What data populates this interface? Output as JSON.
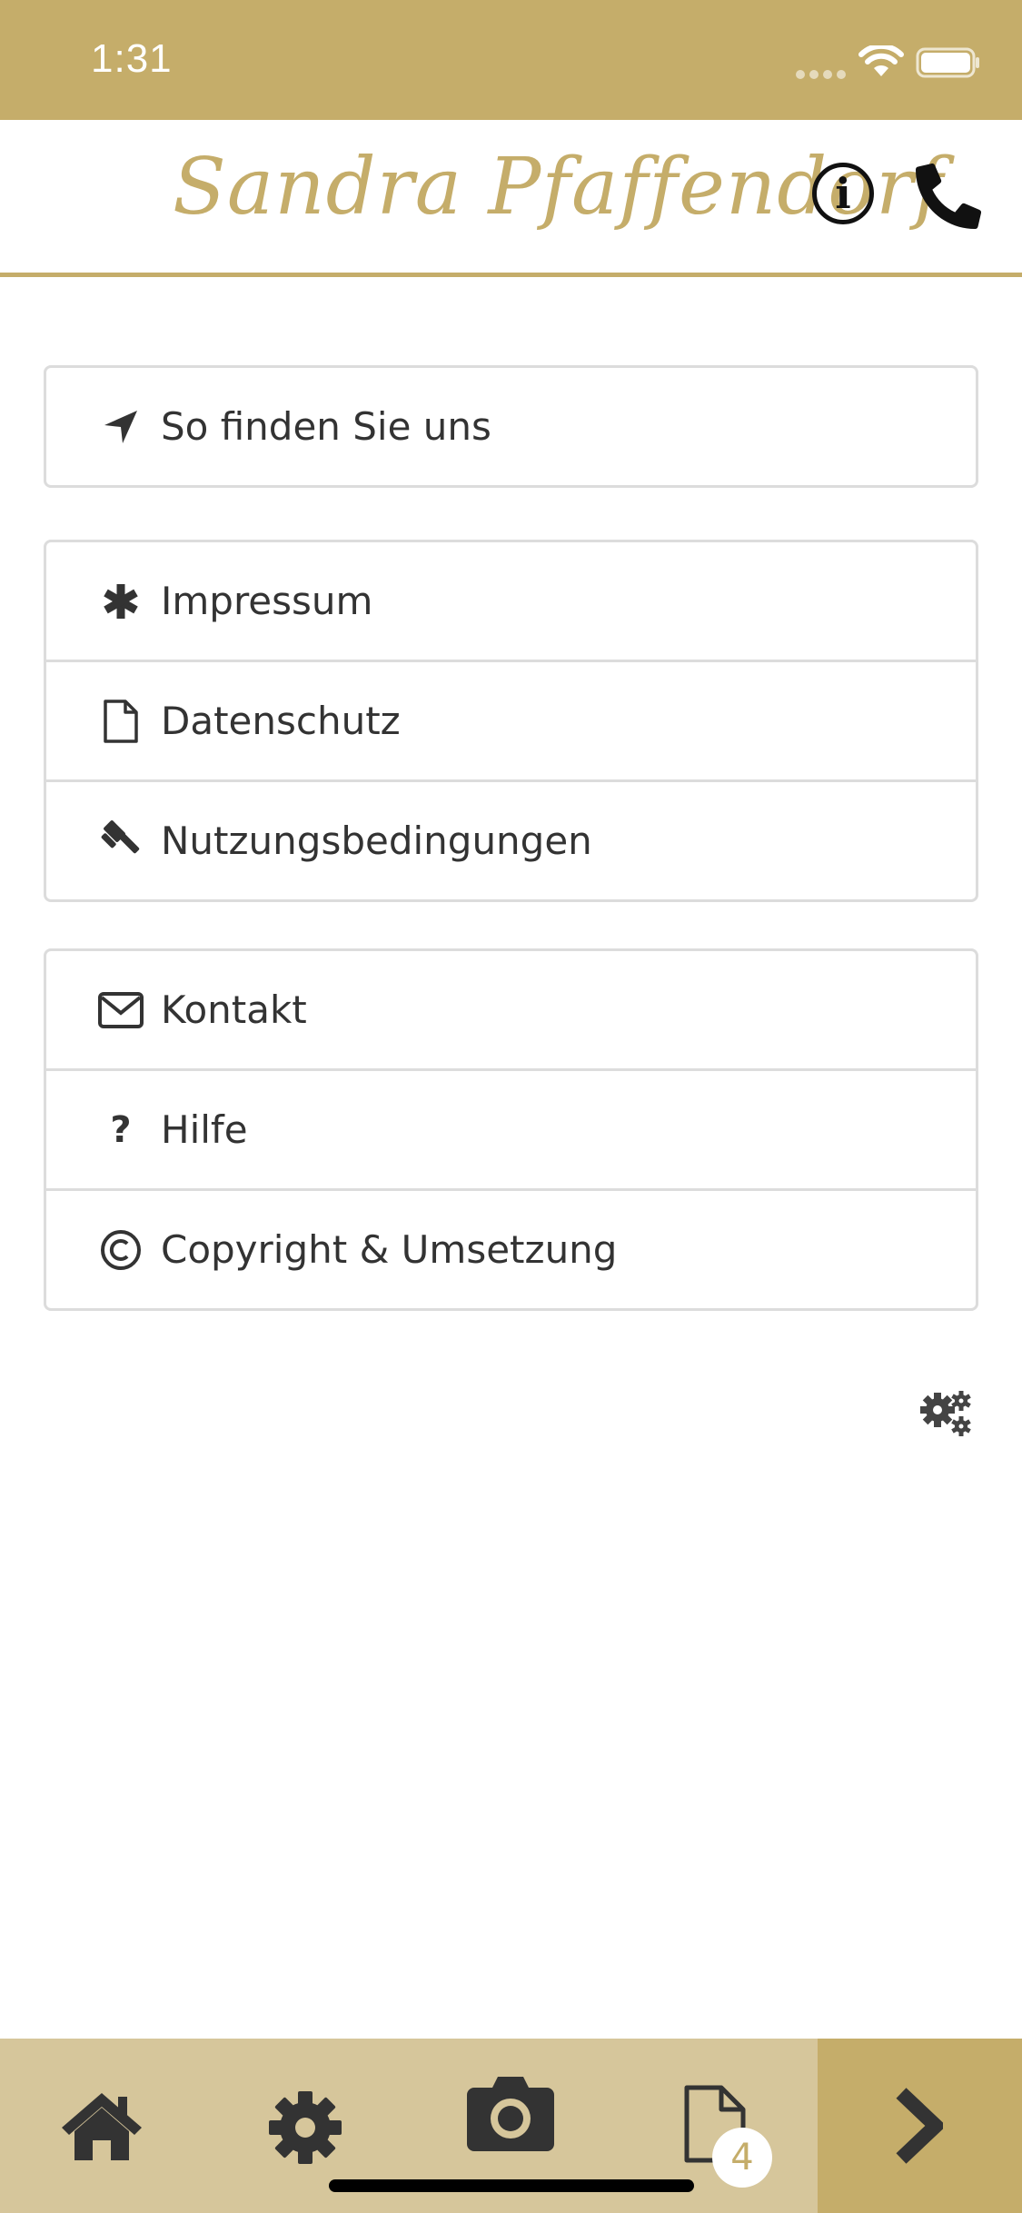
{
  "status_bar": {
    "time": "1:31"
  },
  "header": {
    "brand": "Sandra Pfaffendorf"
  },
  "groups": [
    {
      "items": [
        {
          "label": "So finden Sie uns",
          "icon": "location-arrow-icon"
        }
      ]
    },
    {
      "items": [
        {
          "label": "Impressum",
          "icon": "asterisk-icon"
        },
        {
          "label": "Datenschutz",
          "icon": "document-icon"
        },
        {
          "label": "Nutzungsbedingungen",
          "icon": "gavel-icon"
        }
      ]
    },
    {
      "items": [
        {
          "label": "Kontakt",
          "icon": "envelope-icon"
        },
        {
          "label": "Hilfe",
          "icon": "question-icon"
        },
        {
          "label": "Copyright & Umsetzung",
          "icon": "copyright-icon"
        }
      ]
    }
  ],
  "tabbar": {
    "items": [
      "home-icon",
      "gear-icon",
      "camera-icon",
      "document-icon"
    ],
    "badge_count": "4"
  },
  "colors": {
    "accent": "#c5ad6a",
    "tabbar": "#d6c69b",
    "text": "#333333",
    "border": "#dcdcdc"
  }
}
